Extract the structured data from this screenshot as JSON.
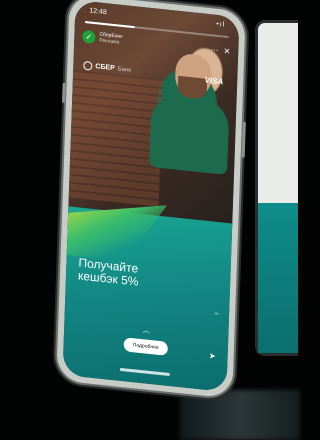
{
  "status_bar": {
    "time": "12:48",
    "signal": "•ıl"
  },
  "story": {
    "account_name": "СберБанк",
    "account_sub": "Реклама",
    "progress_fraction": 0.35,
    "brand_name": "СБЕР",
    "brand_partner": "Банк",
    "card_brand": "VISA",
    "headline_line1": "Получайте",
    "headline_line2": "кешбэк 5%",
    "footnote": "0+",
    "more_button": "Подробнее"
  },
  "icons": {
    "avatar": "sber-logo-icon",
    "menu": "more-dots-icon",
    "close": "close-icon",
    "chevron": "chevron-up-icon",
    "send": "send-icon"
  },
  "colors": {
    "teal": "#138884",
    "sber_green": "#21a038",
    "accent_lime": "#c8e23b"
  }
}
